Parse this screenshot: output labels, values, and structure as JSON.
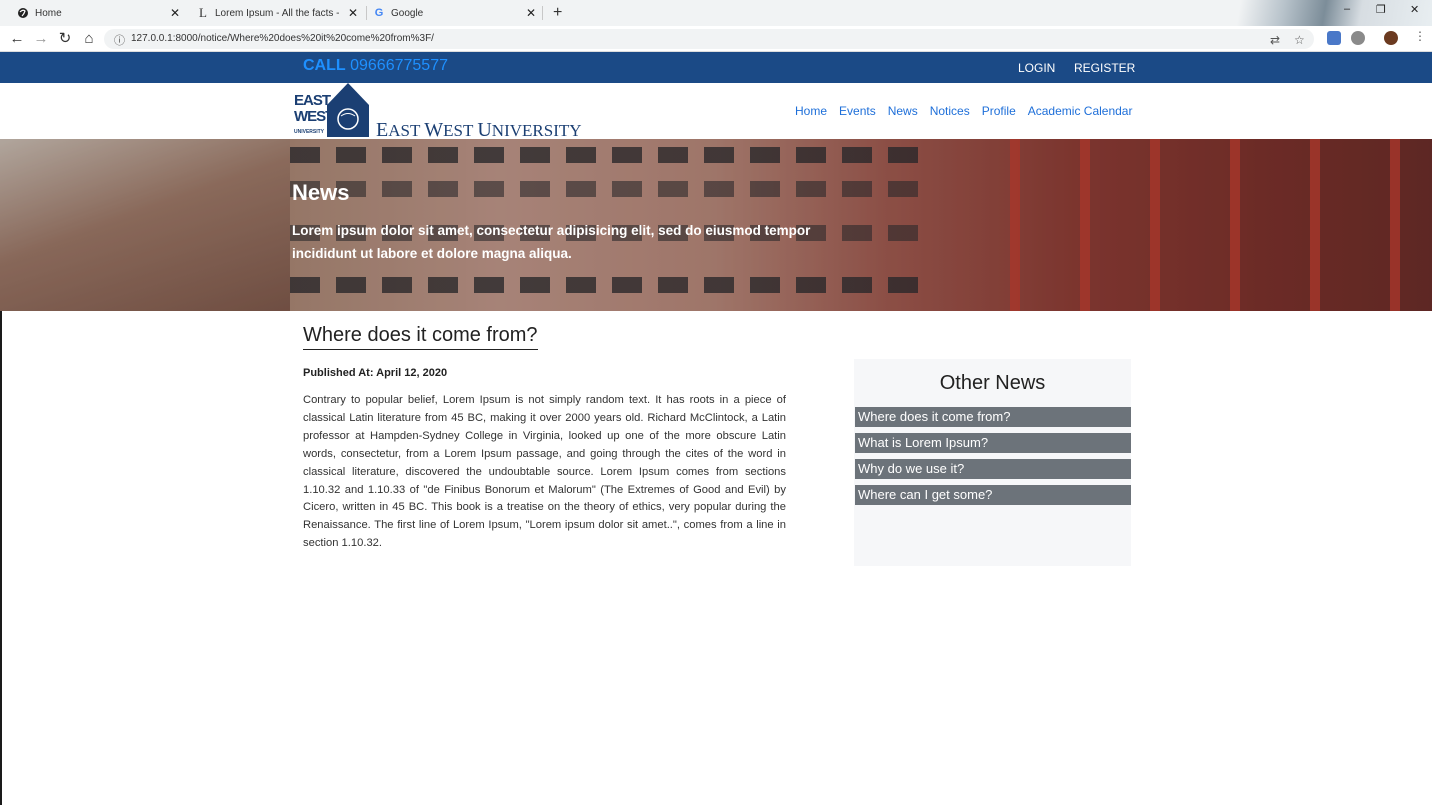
{
  "browser": {
    "tabs": [
      {
        "title": "Home",
        "favicon": "globe-icon"
      },
      {
        "title": "Lorem Ipsum - All the facts - Lipsum",
        "favicon": "lipsum-icon"
      },
      {
        "title": "Google",
        "favicon": "google-icon"
      }
    ],
    "url": "127.0.0.1:8000/notice/Where%20does%20it%20come%20from%3F/"
  },
  "topbar": {
    "call_label": "CALL",
    "phone": "09666775577",
    "login": "LOGIN",
    "register": "REGISTER"
  },
  "logo": {
    "east": "EAST",
    "west": "WEST",
    "university_small": "UNIVERSITY",
    "name_e": "E",
    "name_ast": "AST",
    "name_w": "W",
    "name_est": "EST",
    "name_u": "U",
    "name_niversity": "NIVERSITY"
  },
  "nav": [
    "Home",
    "Events",
    "News",
    "Notices",
    "Profile",
    "Academic Calendar"
  ],
  "hero": {
    "title": "News",
    "subtitle": "Lorem ipsum dolor sit amet, consectetur adipisicing elit, sed do eiusmod tempor incididunt ut labore et dolore magna aliqua."
  },
  "article": {
    "title": "Where does it come from?",
    "published": "Published At: April 12, 2020",
    "body": "Contrary to popular belief, Lorem Ipsum is not simply random text. It has roots in a piece of classical Latin literature from 45 BC, making it over 2000 years old. Richard McClintock, a Latin professor at Hampden-Sydney College in Virginia, looked up one of the more obscure Latin words, consectetur, from a Lorem Ipsum passage, and going through the cites of the word in classical literature, discovered the undoubtable source. Lorem Ipsum comes from sections 1.10.32 and 1.10.33 of \"de Finibus Bonorum et Malorum\" (The Extremes of Good and Evil) by Cicero, written in 45 BC. This book is a treatise on the theory of ethics, very popular during the Renaissance. The first line of Lorem Ipsum, \"Lorem ipsum dolor sit amet..\", comes from a line in section 1.10.32."
  },
  "sidebar": {
    "title": "Other News",
    "items": [
      "Where does it come from?",
      "What is Lorem Ipsum?",
      "Why do we use it?",
      "Where can I get some?"
    ]
  },
  "colors": {
    "topbar": "#1b4a86",
    "phone": "#1e90ff",
    "nav_link": "#1e6fd9",
    "sidebar_item": "#6c737a"
  }
}
